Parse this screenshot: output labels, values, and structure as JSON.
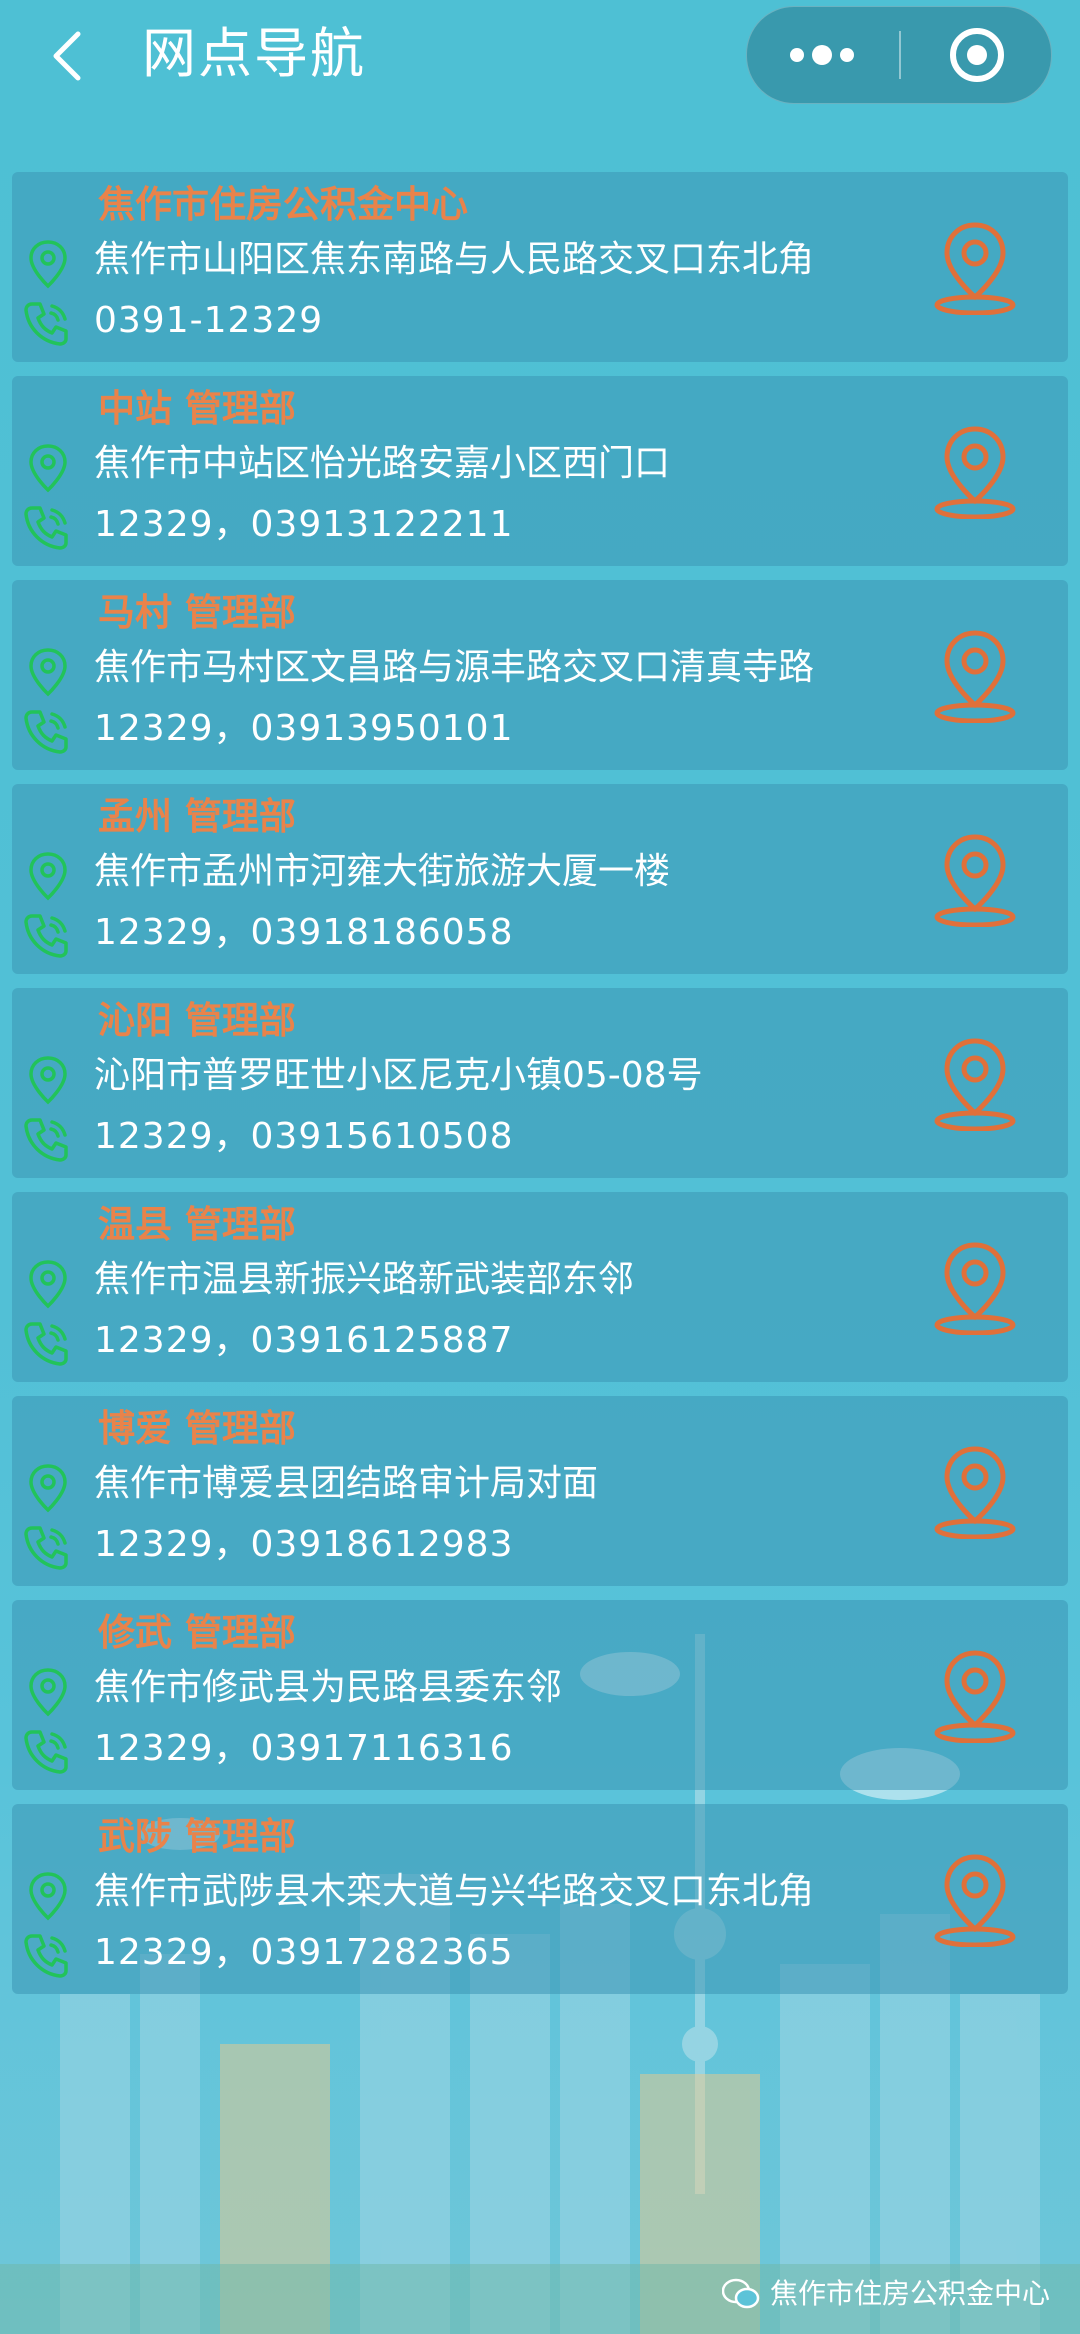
{
  "header": {
    "title": "网点导航"
  },
  "colors": {
    "name": "#e9834a",
    "phone_icon": "#22c35a",
    "pin_icon": "#22c35a",
    "nav_icon": "#e0703a"
  },
  "icons": {
    "address": "location-pin-icon",
    "phone": "phone-icon",
    "navigate": "map-pin-icon",
    "back": "chevron-left-icon",
    "more": "more-dots-icon",
    "close": "target-circle-icon"
  },
  "outlets": [
    {
      "name": "焦作市住房公积金中心",
      "address": "焦作市山阳区焦东南路与人民路交叉口东北角",
      "phone": "0391-12329"
    },
    {
      "name": "中站 管理部",
      "address": "焦作市中站区怡光路安嘉小区西门口",
      "phone": "12329，03913122211"
    },
    {
      "name": "马村 管理部",
      "address": "焦作市马村区文昌路与源丰路交叉口清真寺路",
      "phone": "12329，03913950101"
    },
    {
      "name": "孟州 管理部",
      "address": "焦作市孟州市河雍大街旅游大厦一楼",
      "phone": "12329，03918186058"
    },
    {
      "name": "沁阳 管理部",
      "address": "沁阳市普罗旺世小区尼克小镇05-08号",
      "phone": "12329，03915610508"
    },
    {
      "name": "温县 管理部",
      "address": "焦作市温县新振兴路新武装部东邻",
      "phone": "12329，03916125887"
    },
    {
      "name": "博爱 管理部",
      "address": "焦作市博爱县团结路审计局对面",
      "phone": "12329，03918612983"
    },
    {
      "name": "修武 管理部",
      "address": " 焦作市修武县为民路县委东邻",
      "phone": "12329，03917116316"
    },
    {
      "name": "武陟 管理部",
      "address": "焦作市武陟县木栾大道与兴华路交叉口东北角",
      "phone": "12329，03917282365"
    }
  ],
  "watermark": {
    "text": "焦作市住房公积金中心"
  }
}
